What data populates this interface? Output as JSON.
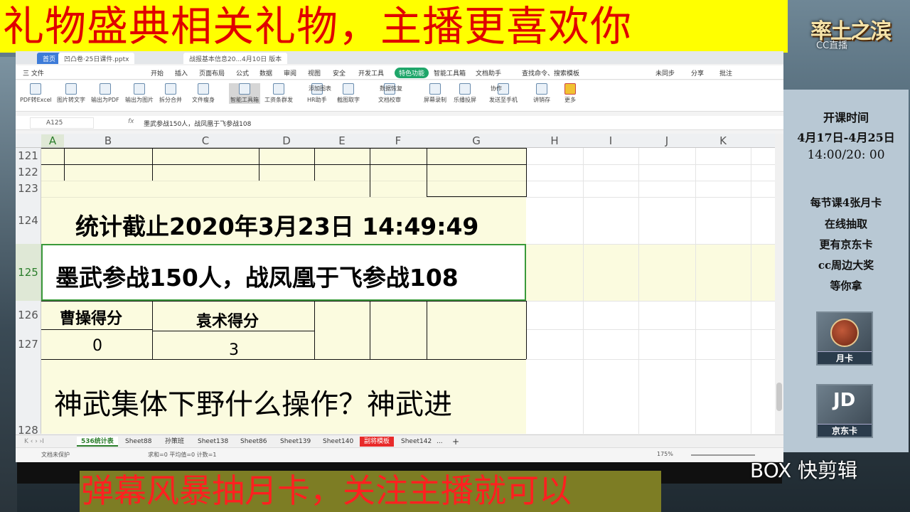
{
  "banners": {
    "top": "礼物盛典相关礼物，主播更喜欢你",
    "bottom": "弹幕风暴抽月卡，关注主播就可以",
    "watermark": "BOX 快剪辑"
  },
  "logo": {
    "text": "率土之滨",
    "sub": "CC直播"
  },
  "window": {
    "tabs": [
      "首页",
      "凹凸卷·25日课件.pptx",
      "战报基本信息20...4月10日 版本"
    ],
    "menus": [
      "三 文件",
      "开始",
      "插入",
      "页面布局",
      "公式",
      "数据",
      "审阅",
      "视图",
      "安全",
      "开发工具",
      "特色功能",
      "智能工具箱",
      "文档助手",
      "查找命令、搜索模板"
    ],
    "menu_right": [
      "未同步",
      "分享",
      "批注"
    ],
    "tools": [
      "PDF转Excel",
      "图片转文字",
      "输出为PDF",
      "输出为图片",
      "拆分合并",
      "文件瘦身",
      "智能工具箱",
      "工资条群发",
      "HR助手",
      "截图取字",
      "文档校审",
      "屏幕录制",
      "乐播投屏",
      "发送至手机",
      "讲销存",
      "更多"
    ],
    "tools_small": [
      "添加图表",
      "数据恢复",
      "协作"
    ],
    "namebox": "A125",
    "fx": "fx",
    "formula": "墨武参战150人，战凤凰于飞参战108"
  },
  "grid": {
    "columns": [
      "A",
      "B",
      "C",
      "D",
      "E",
      "F",
      "G",
      "H",
      "I",
      "J",
      "K"
    ],
    "rows": [
      "121",
      "122",
      "123",
      "124",
      "125",
      "126",
      "127",
      "128"
    ],
    "r124": "统计截止2020年3月23日 14:49:49",
    "r125": "墨武参战150人，战凤凰于飞参战108",
    "r126_b": "曹操得分",
    "r126_c": "袁术得分",
    "r127_b": "0",
    "r127_c": "3",
    "r128": "神武集体下野什么操作？神武进"
  },
  "sheets": [
    "536统计表",
    "Sheet88",
    "孙策班",
    "Sheet138",
    "Sheet86",
    "Sheet139",
    "Sheet140",
    "副将模板",
    "Sheet142",
    "..."
  ],
  "status": {
    "protect": "文档未保护",
    "summary": "求和=0  平均值=0  计数=1",
    "zoom": "175%"
  },
  "right_panel": {
    "title": "开课时间",
    "dates": "4月17日-4月25日",
    "times": "14:00/20: 00",
    "lines": [
      "每节课4张月卡",
      "在线抽取",
      "更有京东卡",
      "cc周边大奖",
      "等你拿"
    ],
    "card1": "月卡",
    "card2": "京东卡",
    "jd": "JD"
  },
  "colors": {
    "banner_yellow": "#ffff00",
    "banner_red": "#e00000",
    "selection_green": "#2a7d2a",
    "cell_yellow": "#fbfbdf",
    "sheet_red": "#e82a2a"
  }
}
